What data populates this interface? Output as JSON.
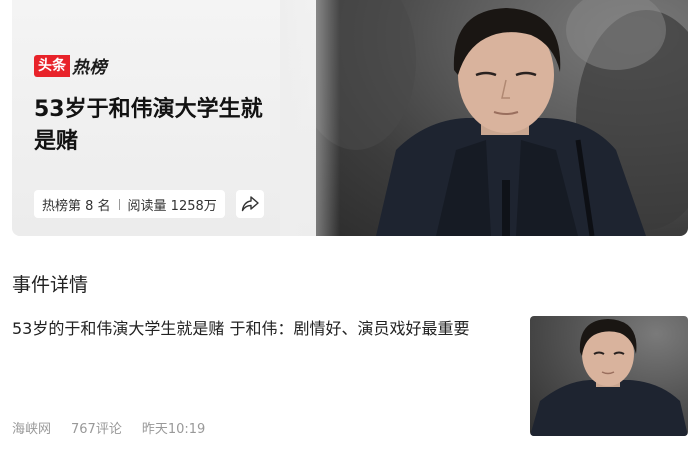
{
  "hot_card": {
    "brand_toutiao": "头条",
    "brand_rebang": "热榜",
    "title": "53岁于和伟演大学生就是赌",
    "rank_text": "热榜第 8 名",
    "read_text": "阅读量 1258万",
    "share_icon": "share-icon"
  },
  "details": {
    "section_title": "事件详情",
    "news": {
      "headline": "53岁的于和伟演大学生就是赌 于和伟：剧情好、演员戏好最重要",
      "source": "海峡网",
      "comments": "767评论",
      "time": "昨天10:19"
    }
  },
  "colors": {
    "brand_red": "#e8232a",
    "meta_gray": "#999999"
  }
}
